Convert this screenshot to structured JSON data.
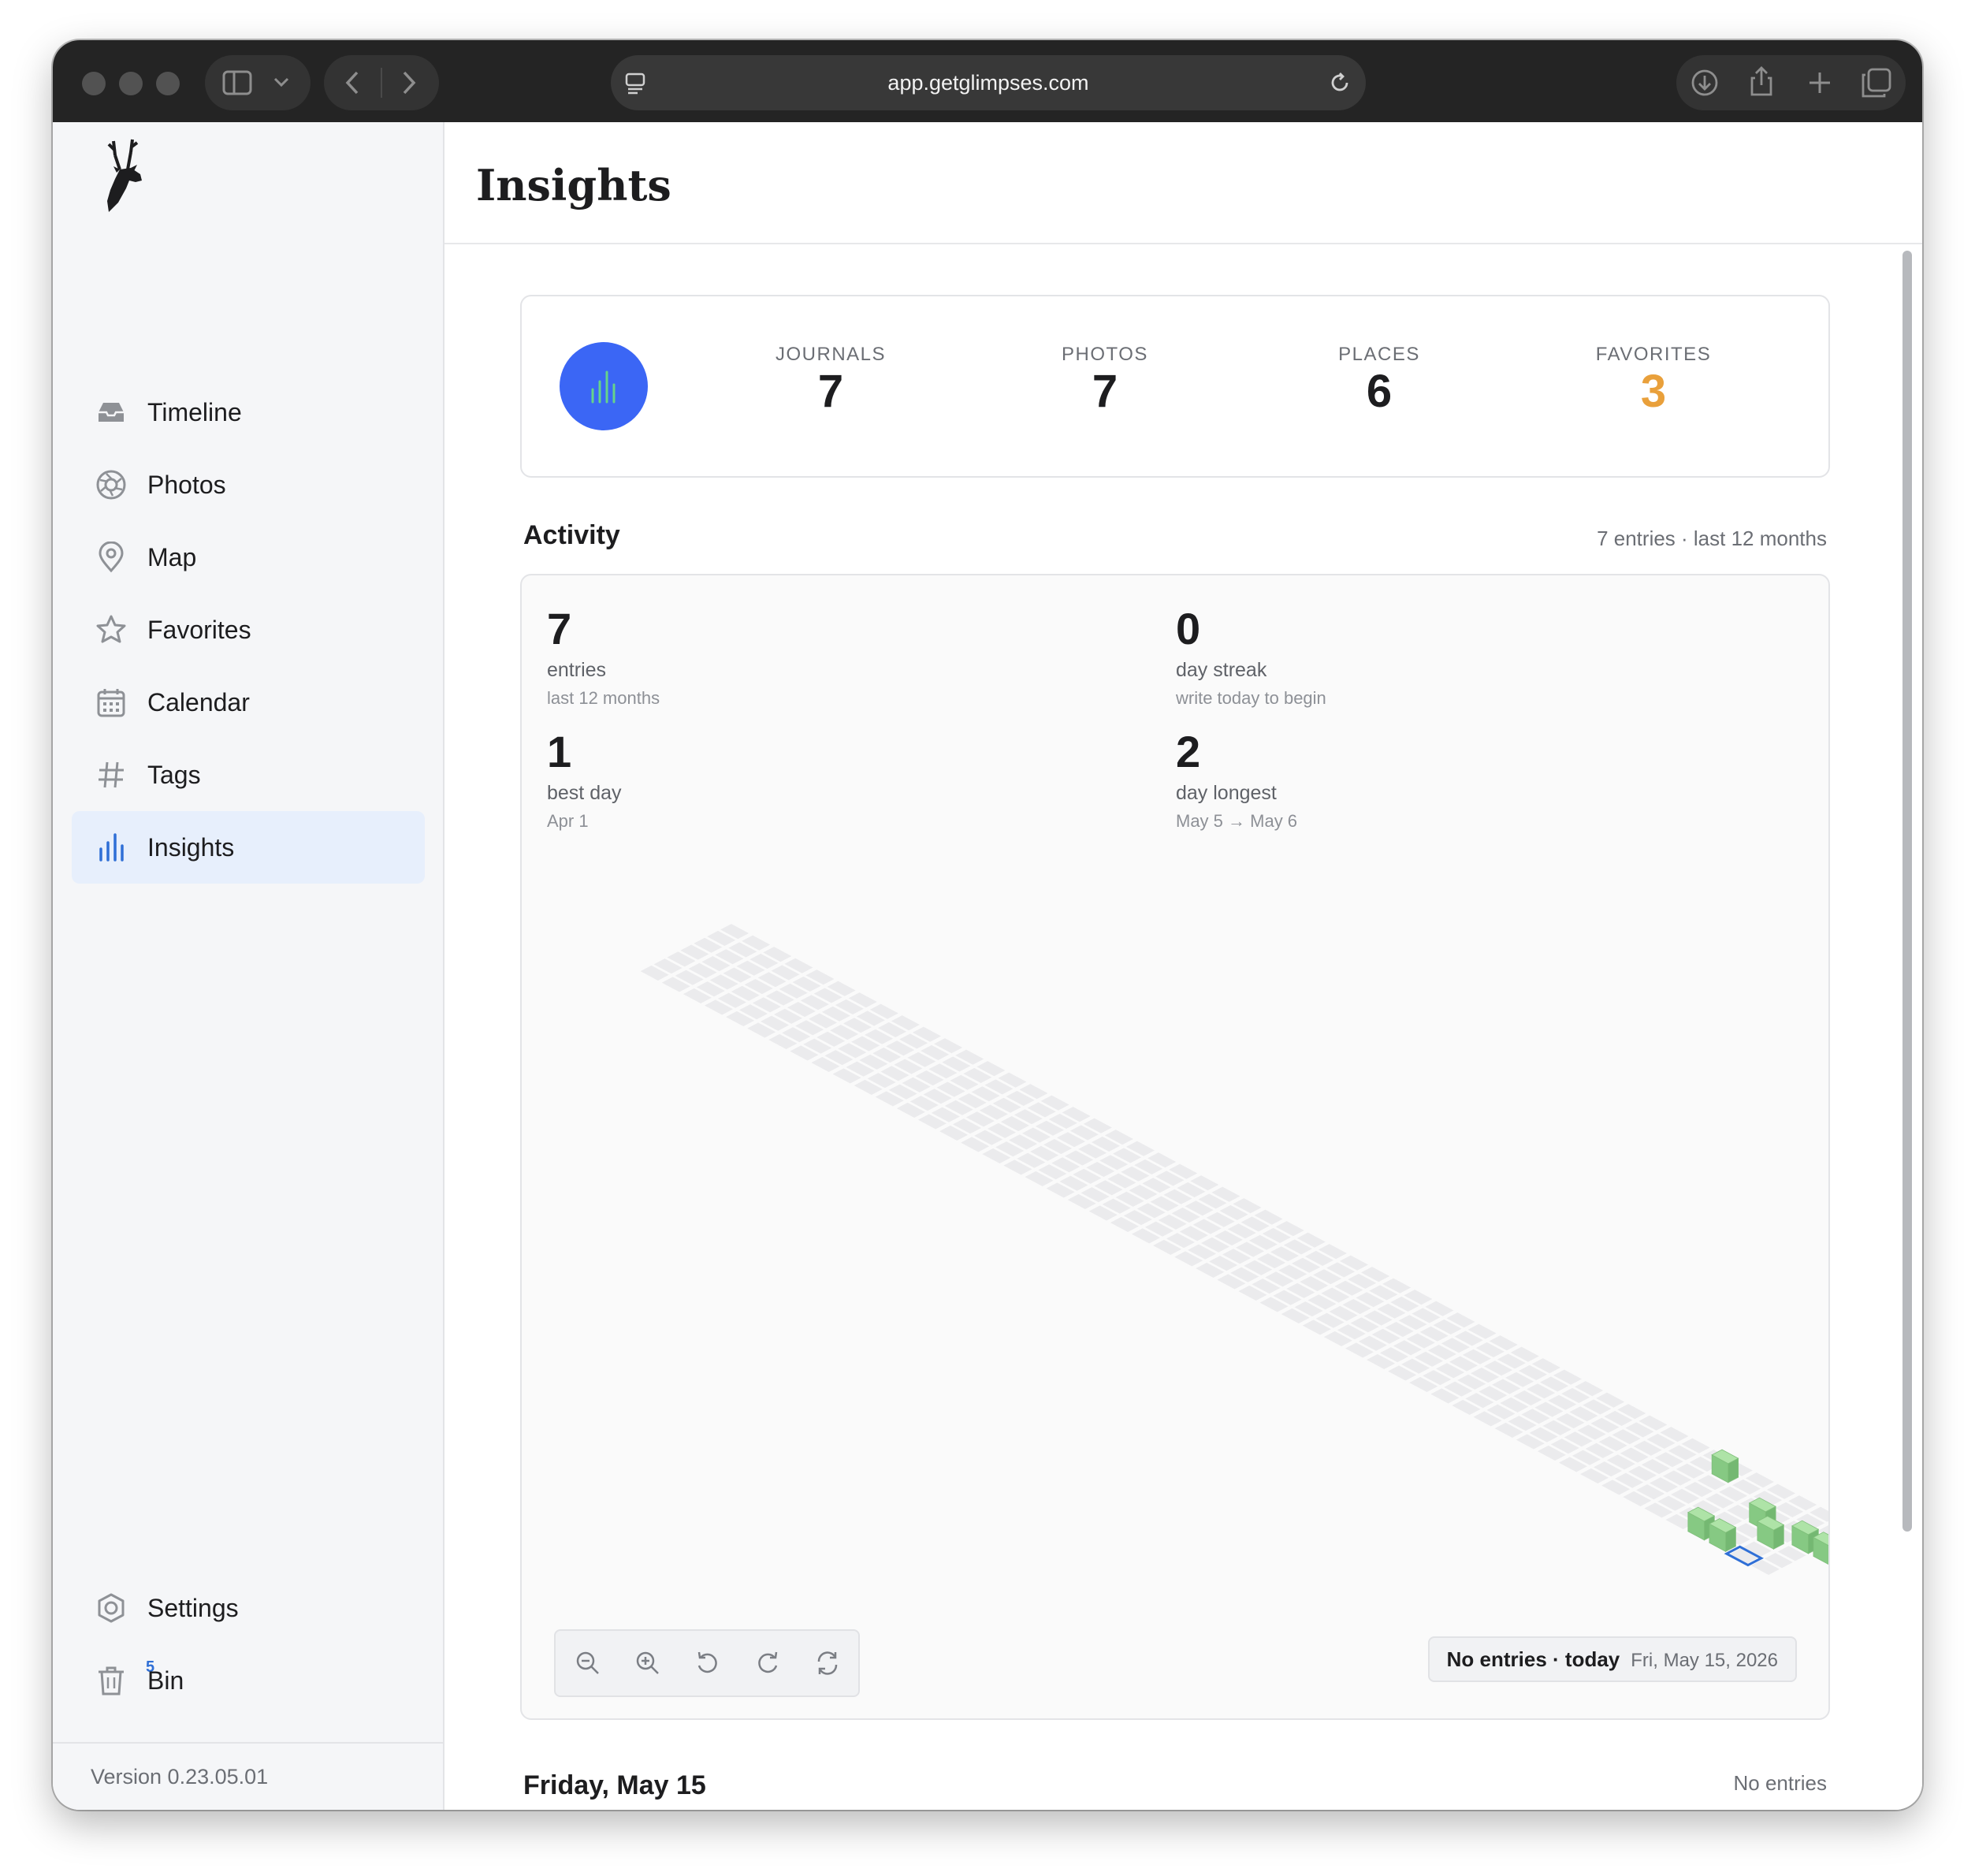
{
  "browser": {
    "url": "app.getglimpses.com"
  },
  "sidebar": {
    "items": [
      {
        "label": "Timeline",
        "icon": "inbox-icon"
      },
      {
        "label": "Photos",
        "icon": "aperture-icon"
      },
      {
        "label": "Map",
        "icon": "map-pin-icon"
      },
      {
        "label": "Favorites",
        "icon": "star-icon"
      },
      {
        "label": "Calendar",
        "icon": "calendar-icon"
      },
      {
        "label": "Tags",
        "icon": "hash-icon"
      },
      {
        "label": "Insights",
        "icon": "bar-chart-icon"
      }
    ],
    "active": "Insights",
    "settings_label": "Settings",
    "bin_label": "Bin",
    "bin_count": "5",
    "version": "Version 0.23.05.01"
  },
  "header": {
    "title": "Insights"
  },
  "stats": {
    "journals": {
      "label": "JOURNALS",
      "value": "7"
    },
    "photos": {
      "label": "PHOTOS",
      "value": "7"
    },
    "places": {
      "label": "PLACES",
      "value": "6"
    },
    "favorites": {
      "label": "FAVORITES",
      "value": "3"
    }
  },
  "activity": {
    "title": "Activity",
    "meta": "7 entries · last 12 months",
    "metrics": {
      "entries": {
        "value": "7",
        "label": "entries",
        "sub": "last 12 months"
      },
      "streak": {
        "value": "0",
        "label": "day streak",
        "sub": "write today to begin"
      },
      "best": {
        "value": "1",
        "label": "best day",
        "sub": "Apr 1"
      },
      "longest": {
        "value": "2",
        "label": "day longest",
        "sub": "May 5 → May 6"
      }
    },
    "status_main": "No entries · today",
    "status_date": "Fri, May 15, 2026",
    "controls": [
      "zoom-out-icon",
      "zoom-in-icon",
      "rotate-left-icon",
      "rotate-right-icon",
      "reset-view-icon"
    ]
  },
  "day_section": {
    "title": "Friday, May 15",
    "meta": "No entries"
  },
  "colors": {
    "accent": "#3b66f5",
    "favorites": "#e9a03b",
    "cube": "#9fdc9a",
    "active_bg": "#e7effc"
  }
}
